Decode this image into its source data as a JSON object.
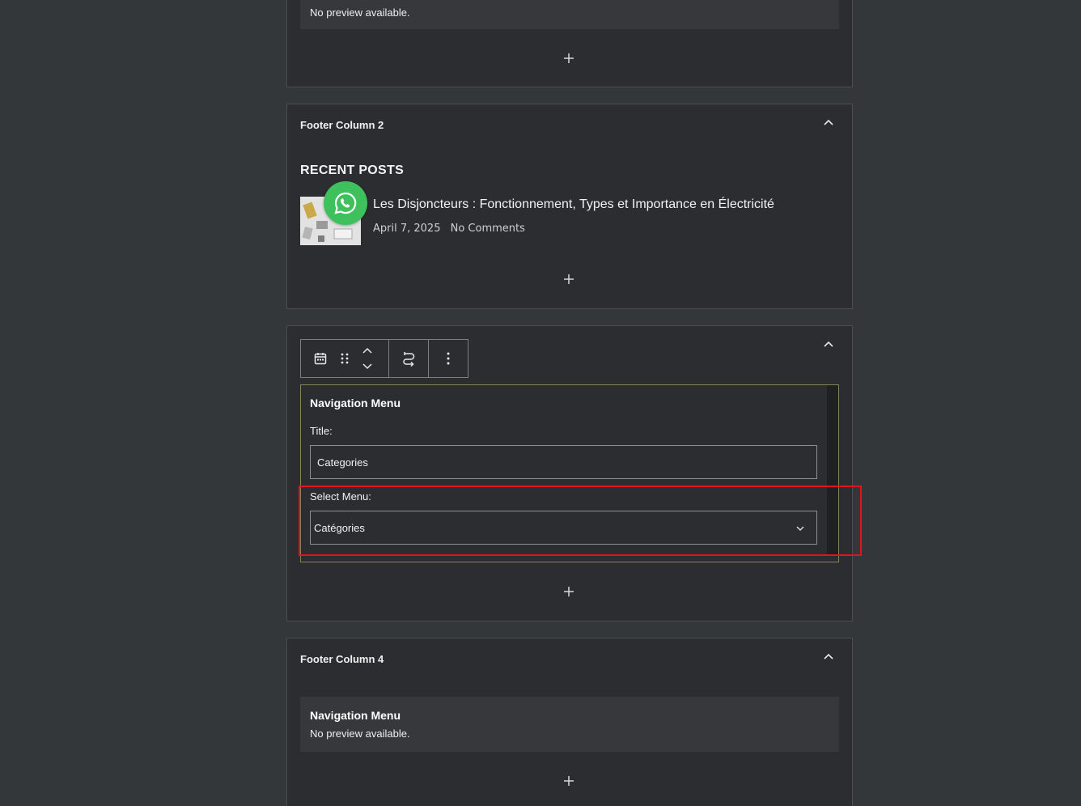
{
  "panel_top": {
    "preview_message": "No preview available."
  },
  "footer_col2": {
    "title": "Footer Column 2",
    "recent_posts_heading": "RECENT POSTS",
    "post_title": "Les Disjoncteurs : Fonctionnement, Types et Importance en Électricité",
    "post_date": "April 7, 2025",
    "post_comments": "No Comments"
  },
  "widget_editor": {
    "form_title": "Navigation Menu",
    "title_label": "Title:",
    "title_value": "Categories",
    "select_label": "Select Menu:",
    "select_value": "Catégories"
  },
  "footer_col4": {
    "title": "Footer Column 4",
    "preview_title": "Navigation Menu",
    "preview_message": "No preview available."
  },
  "colors": {
    "background": "#34373a",
    "panel": "#2c2d30",
    "highlight": "#e3131b",
    "whatsapp": "#3ec15c"
  },
  "icons": [
    "calendar-icon",
    "drag-handle-icon",
    "move-up-icon",
    "move-down-icon",
    "transform-icon",
    "more-options-icon",
    "chevron-up-icon",
    "plus-icon",
    "chevron-down-icon",
    "whatsapp-icon"
  ]
}
